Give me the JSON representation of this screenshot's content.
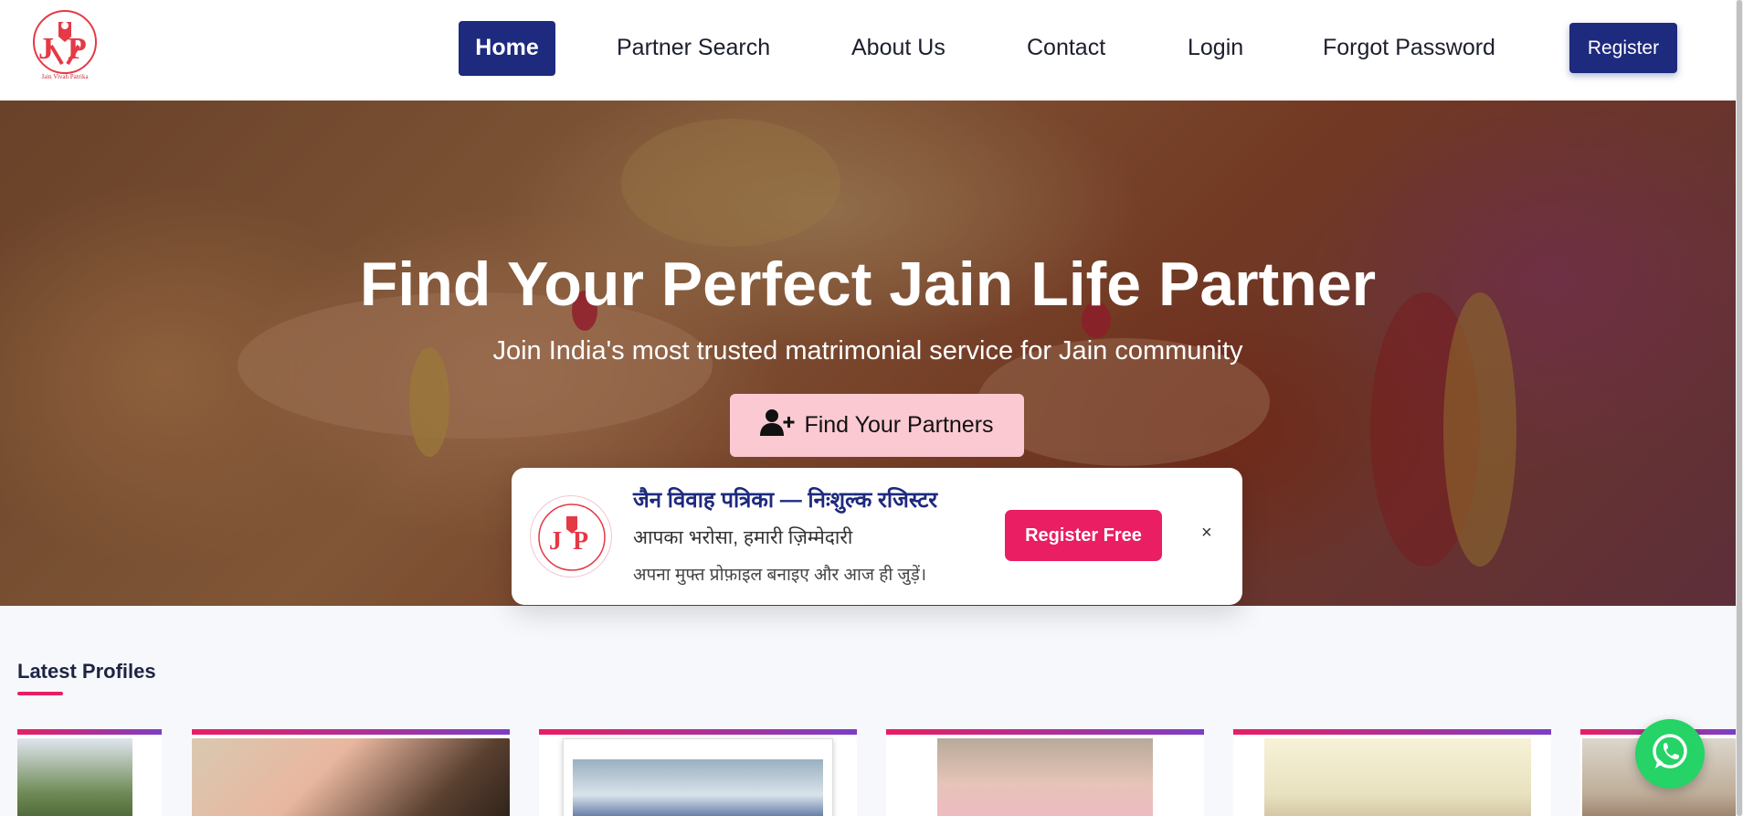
{
  "colors": {
    "brand_navy": "#1e2a7e",
    "accent_pink": "#e91e63",
    "find_btn_bg": "#fbc9d2",
    "whatsapp": "#25d366"
  },
  "logo": {
    "brand_text": "Jain Vivah Patrika",
    "monogram": "J P"
  },
  "nav": {
    "items": [
      "Home",
      "Partner Search",
      "About Us",
      "Contact",
      "Login",
      "Forgot Password"
    ],
    "active": "Home",
    "register_label": "Register"
  },
  "hero": {
    "title": "Find Your Perfect Jain Life Partner",
    "subtitle": "Join India's most trusted matrimonial service for Jain community",
    "cta_label": "Find Your Partners",
    "cta_icon": "user-plus-icon"
  },
  "popup": {
    "title": "जैन विवाह पत्रिका — निःशुल्क रजिस्टर",
    "line1": "आपका भरोसा, हमारी ज़िम्मेदारी",
    "line2": "अपना मुफ्त प्रोफ़ाइल बनाइए और आज ही जुड़ें।",
    "button_label": "Register Free",
    "close_label": "×"
  },
  "latest": {
    "title": "Latest Profiles"
  },
  "whatsapp_icon": "whatsapp-icon"
}
